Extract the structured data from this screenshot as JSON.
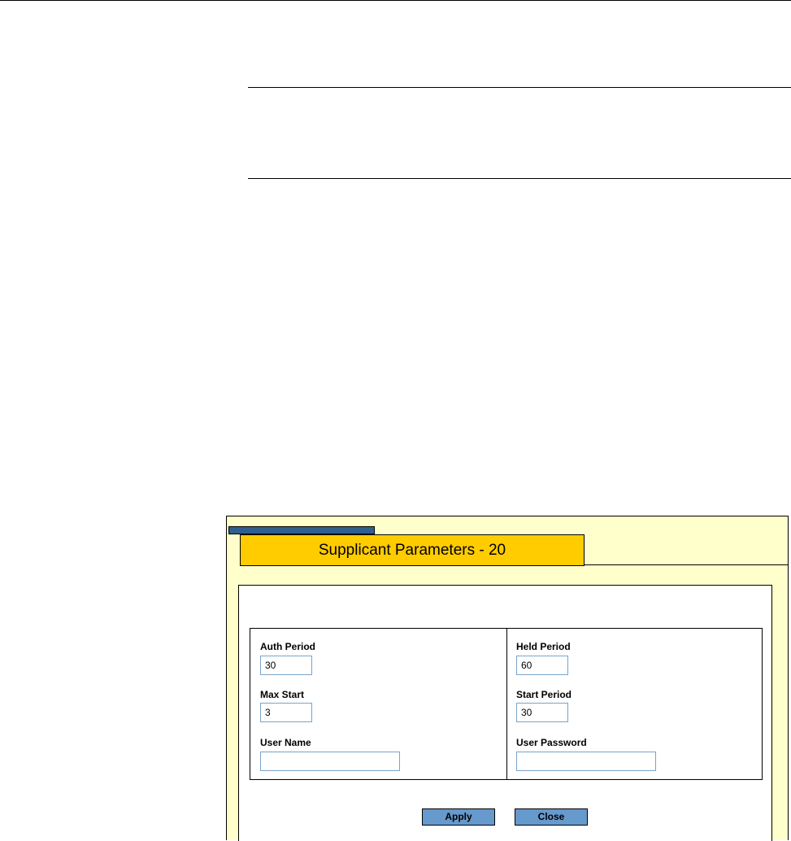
{
  "dialog": {
    "tab_title": "Supplicant Parameters - 20"
  },
  "form": {
    "auth_period": {
      "label": "Auth Period",
      "value": "30"
    },
    "held_period": {
      "label": "Held Period",
      "value": "60"
    },
    "max_start": {
      "label": "Max Start",
      "value": "3"
    },
    "start_period": {
      "label": "Start Period",
      "value": "30"
    },
    "user_name": {
      "label": "User Name",
      "value": ""
    },
    "user_password": {
      "label": "User Password",
      "value": ""
    }
  },
  "buttons": {
    "apply": "Apply",
    "close": "Close"
  },
  "colors": {
    "panel_background": "#ffffcc",
    "tab_background": "#ffcc00",
    "tab_accent": "#2f5f8f",
    "button": "#6699cc",
    "field_border": "#7aa3c8"
  }
}
